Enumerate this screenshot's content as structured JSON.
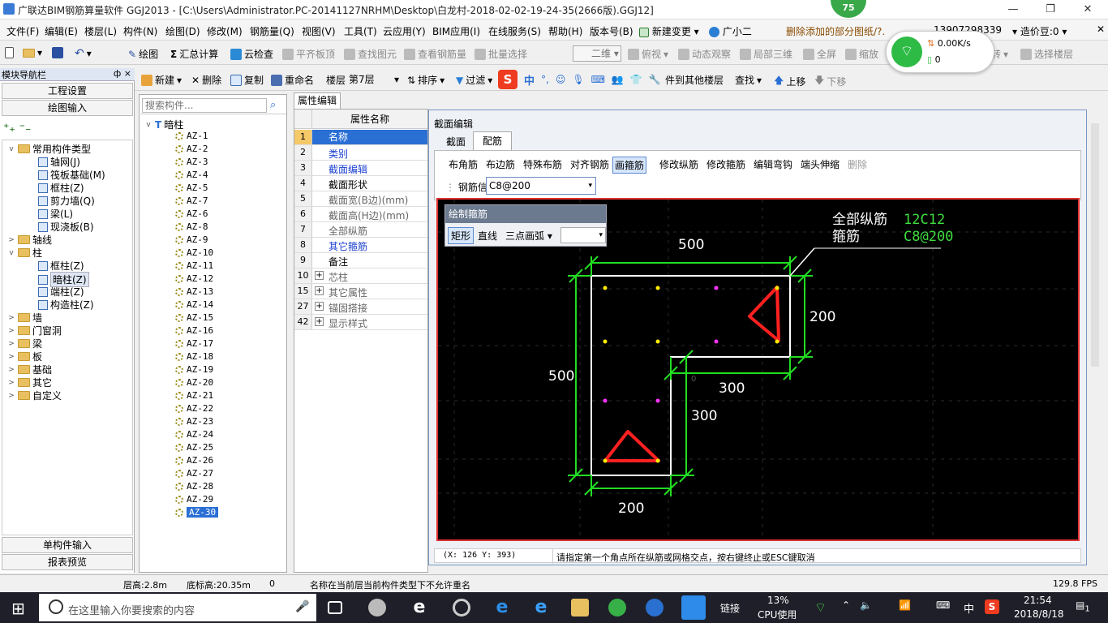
{
  "colors": {
    "canvas_bg": "#000000",
    "dim": "#22dd22",
    "outline": "#ffffff",
    "stirrup": "#ff2020",
    "accent_red": "#e03030",
    "green_text": "#3fdc3f"
  },
  "titlebar": {
    "title": "广联达BIM钢筋算量软件 GGJ2013 - [C:\\Users\\Administrator.PC-20141127NRHM\\Desktop\\白龙村-2018-02-02-19-24-35(2666版).GGJ12]",
    "badge": "75"
  },
  "menu": [
    "文件(F)",
    "编辑(E)",
    "楼层(L)",
    "构件(N)",
    "绘图(D)",
    "修改(M)",
    "钢筋量(Q)",
    "视图(V)",
    "工具(T)",
    "云应用(Y)",
    "BIM应用(I)",
    "在线服务(S)",
    "帮助(H)",
    "版本号(B)",
    "新建变更",
    "广小二"
  ],
  "menu_right": {
    "notice": "删除添加的部分图纸/?.",
    "phone": "13907298339",
    "cost": "造价豆:0"
  },
  "network": {
    "speed": "0.00K/s",
    "count": "0"
  },
  "toolbar1": {
    "draw": "绘图",
    "calc": "汇总计算",
    "cloud_check": "云检查",
    "flat_board": "平齐板顶",
    "find_elem": "查找图元",
    "view_rebar": "查看钢筋量",
    "batch_select": "批量选择",
    "view_mode": "二维",
    "top_view": "俯视",
    "dyn_observe": "动态观察",
    "local_3d": "局部三维",
    "fullscreen": "全屏",
    "zoom": "缩放",
    "rotate": "旋转",
    "select_floor": "选择楼层"
  },
  "toolbar2": {
    "new": "新建",
    "delete": "删除",
    "copy": "复制",
    "rename": "重命名",
    "floor_label": "楼层",
    "floor_value": "第7层",
    "sort": "排序",
    "filter": "过滤",
    "copy_to_floor": "件到其他楼层",
    "find": "查找",
    "move_up": "上移",
    "move_down": "下移"
  },
  "leftnav": {
    "header": "模块导航栏",
    "pin": "ф ×",
    "top_buttons": [
      "工程设置",
      "绘图输入"
    ],
    "bottom_buttons": [
      "单构件输入",
      "报表预览"
    ],
    "tree": [
      {
        "label": "常用构件类型",
        "level": 1,
        "type": "folder",
        "expand": "v"
      },
      {
        "label": "轴网(J)",
        "level": 2,
        "type": "item"
      },
      {
        "label": "筏板基础(M)",
        "level": 2,
        "type": "item"
      },
      {
        "label": "框柱(Z)",
        "level": 2,
        "type": "item"
      },
      {
        "label": "剪力墙(Q)",
        "level": 2,
        "type": "item"
      },
      {
        "label": "梁(L)",
        "level": 2,
        "type": "item"
      },
      {
        "label": "现浇板(B)",
        "level": 2,
        "type": "item"
      },
      {
        "label": "轴线",
        "level": 1,
        "type": "folder",
        "expand": ">"
      },
      {
        "label": "柱",
        "level": 1,
        "type": "folder",
        "expand": "v"
      },
      {
        "label": "框柱(Z)",
        "level": 2,
        "type": "item"
      },
      {
        "label": "暗柱(Z)",
        "level": 2,
        "type": "item",
        "selected": true
      },
      {
        "label": "端柱(Z)",
        "level": 2,
        "type": "item"
      },
      {
        "label": "构造柱(Z)",
        "level": 2,
        "type": "item"
      },
      {
        "label": "墙",
        "level": 1,
        "type": "folder",
        "expand": ">"
      },
      {
        "label": "门窗洞",
        "level": 1,
        "type": "folder",
        "expand": ">"
      },
      {
        "label": "梁",
        "level": 1,
        "type": "folder",
        "expand": ">"
      },
      {
        "label": "板",
        "level": 1,
        "type": "folder",
        "expand": ">"
      },
      {
        "label": "基础",
        "level": 1,
        "type": "folder",
        "expand": ">"
      },
      {
        "label": "其它",
        "level": 1,
        "type": "folder",
        "expand": ">"
      },
      {
        "label": "自定义",
        "level": 1,
        "type": "folder",
        "expand": ">"
      }
    ]
  },
  "complist": {
    "search_placeholder": "搜索构件...",
    "root": "暗柱",
    "items": [
      "AZ-1",
      "AZ-2",
      "AZ-3",
      "AZ-4",
      "AZ-5",
      "AZ-7",
      "AZ-6",
      "AZ-8",
      "AZ-9",
      "AZ-10",
      "AZ-11",
      "AZ-12",
      "AZ-13",
      "AZ-14",
      "AZ-15",
      "AZ-16",
      "AZ-17",
      "AZ-18",
      "AZ-19",
      "AZ-20",
      "AZ-21",
      "AZ-22",
      "AZ-23",
      "AZ-24",
      "AZ-25",
      "AZ-26",
      "AZ-27",
      "AZ-28",
      "AZ-29",
      "AZ-30"
    ],
    "selected": "AZ-30"
  },
  "propgrid": {
    "tab": "属性编辑",
    "header": "属性名称",
    "rows": [
      {
        "num": "1",
        "label": "名称",
        "style": "selected"
      },
      {
        "num": "2",
        "label": "类别",
        "style": "blue"
      },
      {
        "num": "3",
        "label": "截面编辑",
        "style": "blue"
      },
      {
        "num": "4",
        "label": "截面形状",
        "style": "normal"
      },
      {
        "num": "5",
        "label": "截面宽(B边)(mm)",
        "style": "gray"
      },
      {
        "num": "6",
        "label": "截面高(H边)(mm)",
        "style": "gray"
      },
      {
        "num": "7",
        "label": "全部纵筋",
        "style": "gray"
      },
      {
        "num": "8",
        "label": "其它箍筋",
        "style": "blue"
      },
      {
        "num": "9",
        "label": "备注",
        "style": "normal"
      },
      {
        "num": "10",
        "label": "芯柱",
        "style": "gray",
        "plus": true
      },
      {
        "num": "15",
        "label": "其它属性",
        "style": "gray",
        "plus": true
      },
      {
        "num": "27",
        "label": "锚固搭接",
        "style": "gray",
        "plus": true
      },
      {
        "num": "42",
        "label": "显示样式",
        "style": "gray",
        "plus": true
      }
    ]
  },
  "section": {
    "title": "截面编辑",
    "tabs": [
      "截面",
      "配筋"
    ],
    "tools": [
      "布角筋",
      "布边筋",
      "特殊布筋",
      "对齐钢筋",
      "画箍筋",
      "修改纵筋",
      "修改箍筋",
      "编辑弯钩",
      "端头伸缩",
      "删除"
    ],
    "active_tool": "画箍筋",
    "rebar_info_label": "钢筋信息",
    "rebar_info_value": "C8@200",
    "draw_panel": {
      "title": "绘制箍筋",
      "rect": "矩形",
      "line": "直线",
      "arc": "三点画弧"
    },
    "annot_label1": "全部纵筋",
    "annot_label2": "箍筋",
    "annot_value1": "12C12",
    "annot_value2": "C8@200",
    "dims": {
      "top": "500",
      "left": "500",
      "right_top": "200",
      "mid": "300",
      "right_low": "300",
      "bottom": "200"
    },
    "origin_mark": "0",
    "coords": "(X: 126 Y: 393)",
    "hint": "请指定第一个角点所在纵筋或网格交点，按右键终止或ESC键取消"
  },
  "statusbar": {
    "floor_height": "层高:2.8m",
    "base_height": "底标高:20.35m",
    "zero": "0",
    "message": "名称在当前层当前构件类型下不允许重名",
    "fps": "129.8 FPS"
  },
  "taskbar": {
    "search_placeholder": "在这里输入你要搜索的内容",
    "link": "链接",
    "cpu_value": "13%",
    "cpu_label": "CPU使用",
    "ime": "中",
    "time": "21:54",
    "date": "2018/8/18",
    "notif": "1"
  }
}
